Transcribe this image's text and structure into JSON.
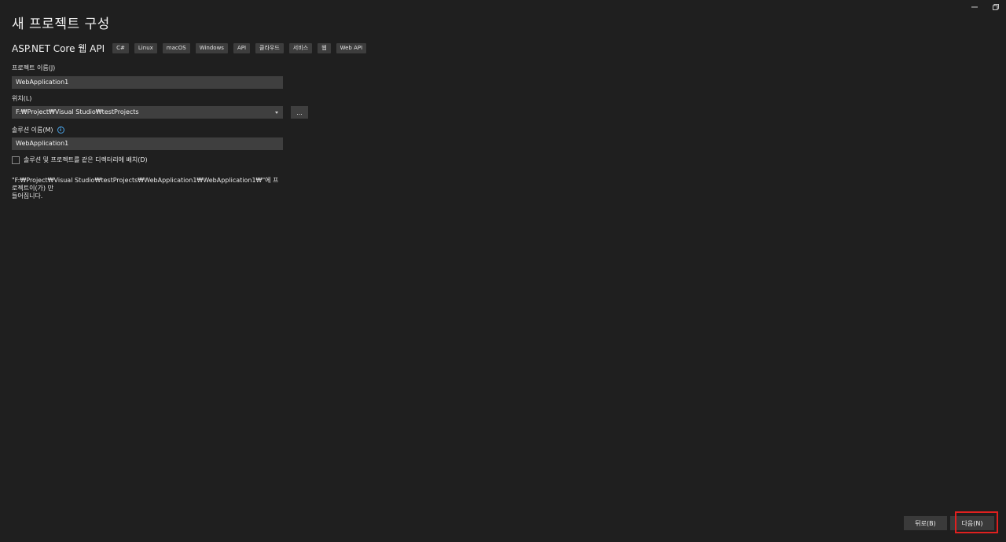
{
  "window": {
    "title": "새 프로젝트 구성",
    "controls": {
      "minimize": "—",
      "restore": "❐"
    }
  },
  "template": {
    "name": "ASP.NET Core 웹 API",
    "tags": [
      "C#",
      "Linux",
      "macOS",
      "Windows",
      "API",
      "클라우드",
      "서비스",
      "웹",
      "Web API"
    ]
  },
  "form": {
    "project_name_label": "프로젝트 이름(J)",
    "project_name_value": "WebApplication1",
    "location_label": "위치(L)",
    "location_value": "F:₩Project₩Visual Studio₩testProjects",
    "browse_label": "...",
    "solution_name_label": "솔루션 이름(M)",
    "solution_name_value": "WebApplication1",
    "same_dir_label": "솔루션 및 프로젝트를 같은 디렉터리에 배치(D)",
    "summary_line1": "\"F:₩Project₩Visual Studio₩testProjects₩WebApplication1₩WebApplication1₩\"에 프로젝트이(가) 만",
    "summary_line2": "들어집니다."
  },
  "footer": {
    "back_label": "뒤로(B)",
    "next_label": "다음(N)"
  },
  "colors": {
    "background": "#1f1f1f",
    "input": "#3f3f3f",
    "tag": "#3d3d3d",
    "highlight": "#e0201f",
    "info": "#4aa3e8"
  }
}
